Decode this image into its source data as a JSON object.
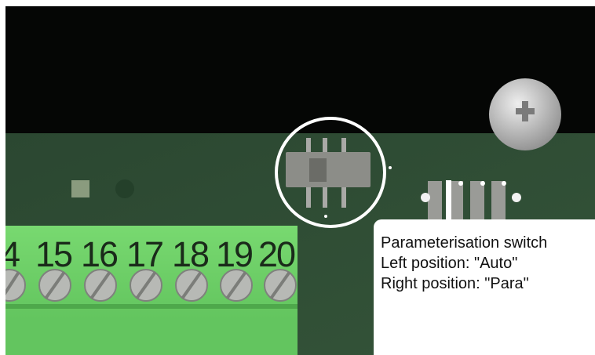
{
  "photo": {
    "subject": "circuit-board-parameterisation-switch",
    "terminal_numbers": [
      "4",
      "15",
      "16",
      "17",
      "18",
      "19",
      "20"
    ]
  },
  "callout": {
    "title": "Parameterisation switch",
    "left_position": "Left position: \"Auto\"",
    "right_position": "Right position: \"Para\""
  },
  "colors": {
    "pcb": "#2f4b35",
    "terminal_block": "#6ed06a",
    "background": "#050605",
    "highlight_circle": "#ffffff"
  }
}
